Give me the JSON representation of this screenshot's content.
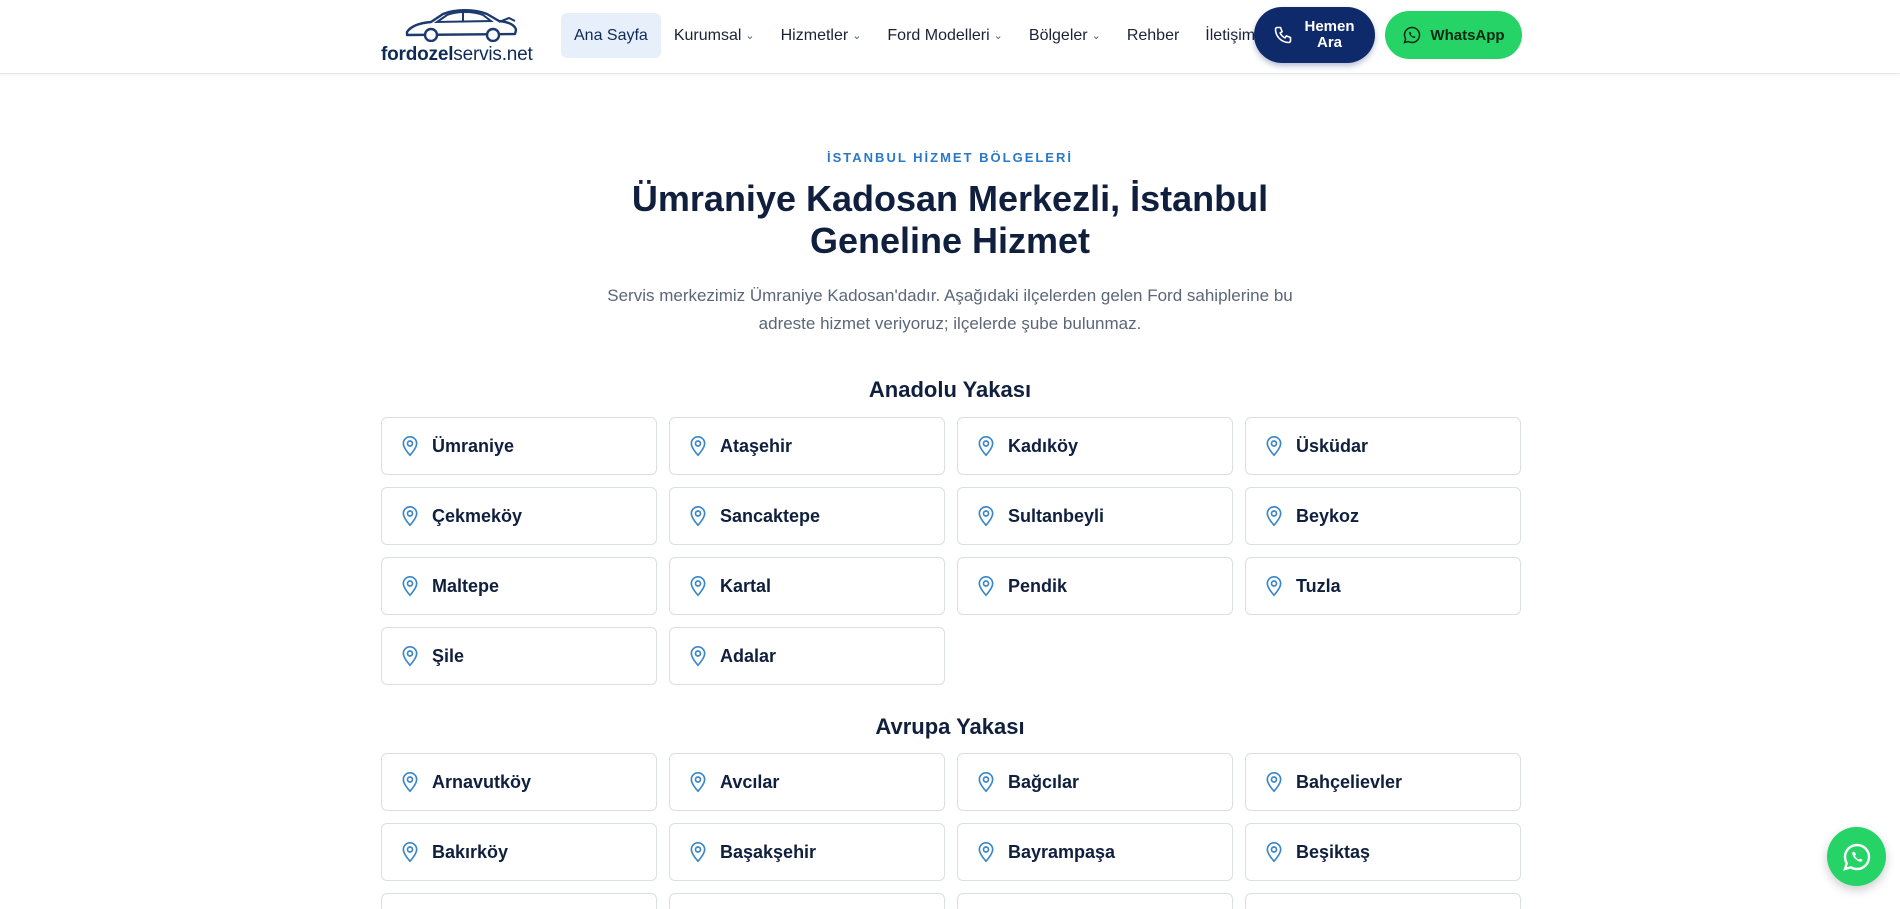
{
  "header": {
    "logo": {
      "text_bold": "fordozel",
      "text_regular": "servis.net"
    },
    "nav": [
      {
        "label": "Ana Sayfa",
        "dropdown": false,
        "active": true
      },
      {
        "label": "Kurumsal",
        "dropdown": true
      },
      {
        "label": "Hizmetler",
        "dropdown": true
      },
      {
        "label": "Ford Modelleri",
        "dropdown": true
      },
      {
        "label": "Bölgeler",
        "dropdown": true
      },
      {
        "label": "Rehber",
        "dropdown": false
      },
      {
        "label": "İletişim",
        "dropdown": false
      }
    ],
    "call_button": "Hemen Ara",
    "whatsapp_button": "WhatsApp"
  },
  "hero": {
    "eyebrow": "İSTANBUL HİZMET BÖLGELERİ",
    "title": "Ümraniye Kadosan Merkezli, İstanbul Geneline Hizmet",
    "subtitle": "Servis merkezimiz Ümraniye Kadosan'dadır. Aşağıdaki ilçelerden gelen Ford sahiplerine bu adreste hizmet veriyoruz; ilçelerde şube bulunmaz."
  },
  "sections": [
    {
      "title": "Anadolu Yakası",
      "districts": [
        "Ümraniye",
        "Ataşehir",
        "Kadıköy",
        "Üsküdar",
        "Çekmeköy",
        "Sancaktepe",
        "Sultanbeyli",
        "Beykoz",
        "Maltepe",
        "Kartal",
        "Pendik",
        "Tuzla",
        "Şile",
        "Adalar"
      ]
    },
    {
      "title": "Avrupa Yakası",
      "districts": [
        "Arnavutköy",
        "Avcılar",
        "Bağcılar",
        "Bahçelievler",
        "Bakırköy",
        "Başakşehir",
        "Bayrampaşa",
        "Beşiktaş",
        "",
        "",
        "",
        ""
      ]
    }
  ],
  "colors": {
    "navy": "#0f2a6b",
    "whatsapp": "#25d366",
    "accent_blue": "#2a78c8",
    "pin_blue": "#3a86c8"
  },
  "icons": {
    "call": "phone-icon",
    "whatsapp": "whatsapp-icon",
    "district": "map-pin-icon",
    "logo": "car-icon"
  }
}
